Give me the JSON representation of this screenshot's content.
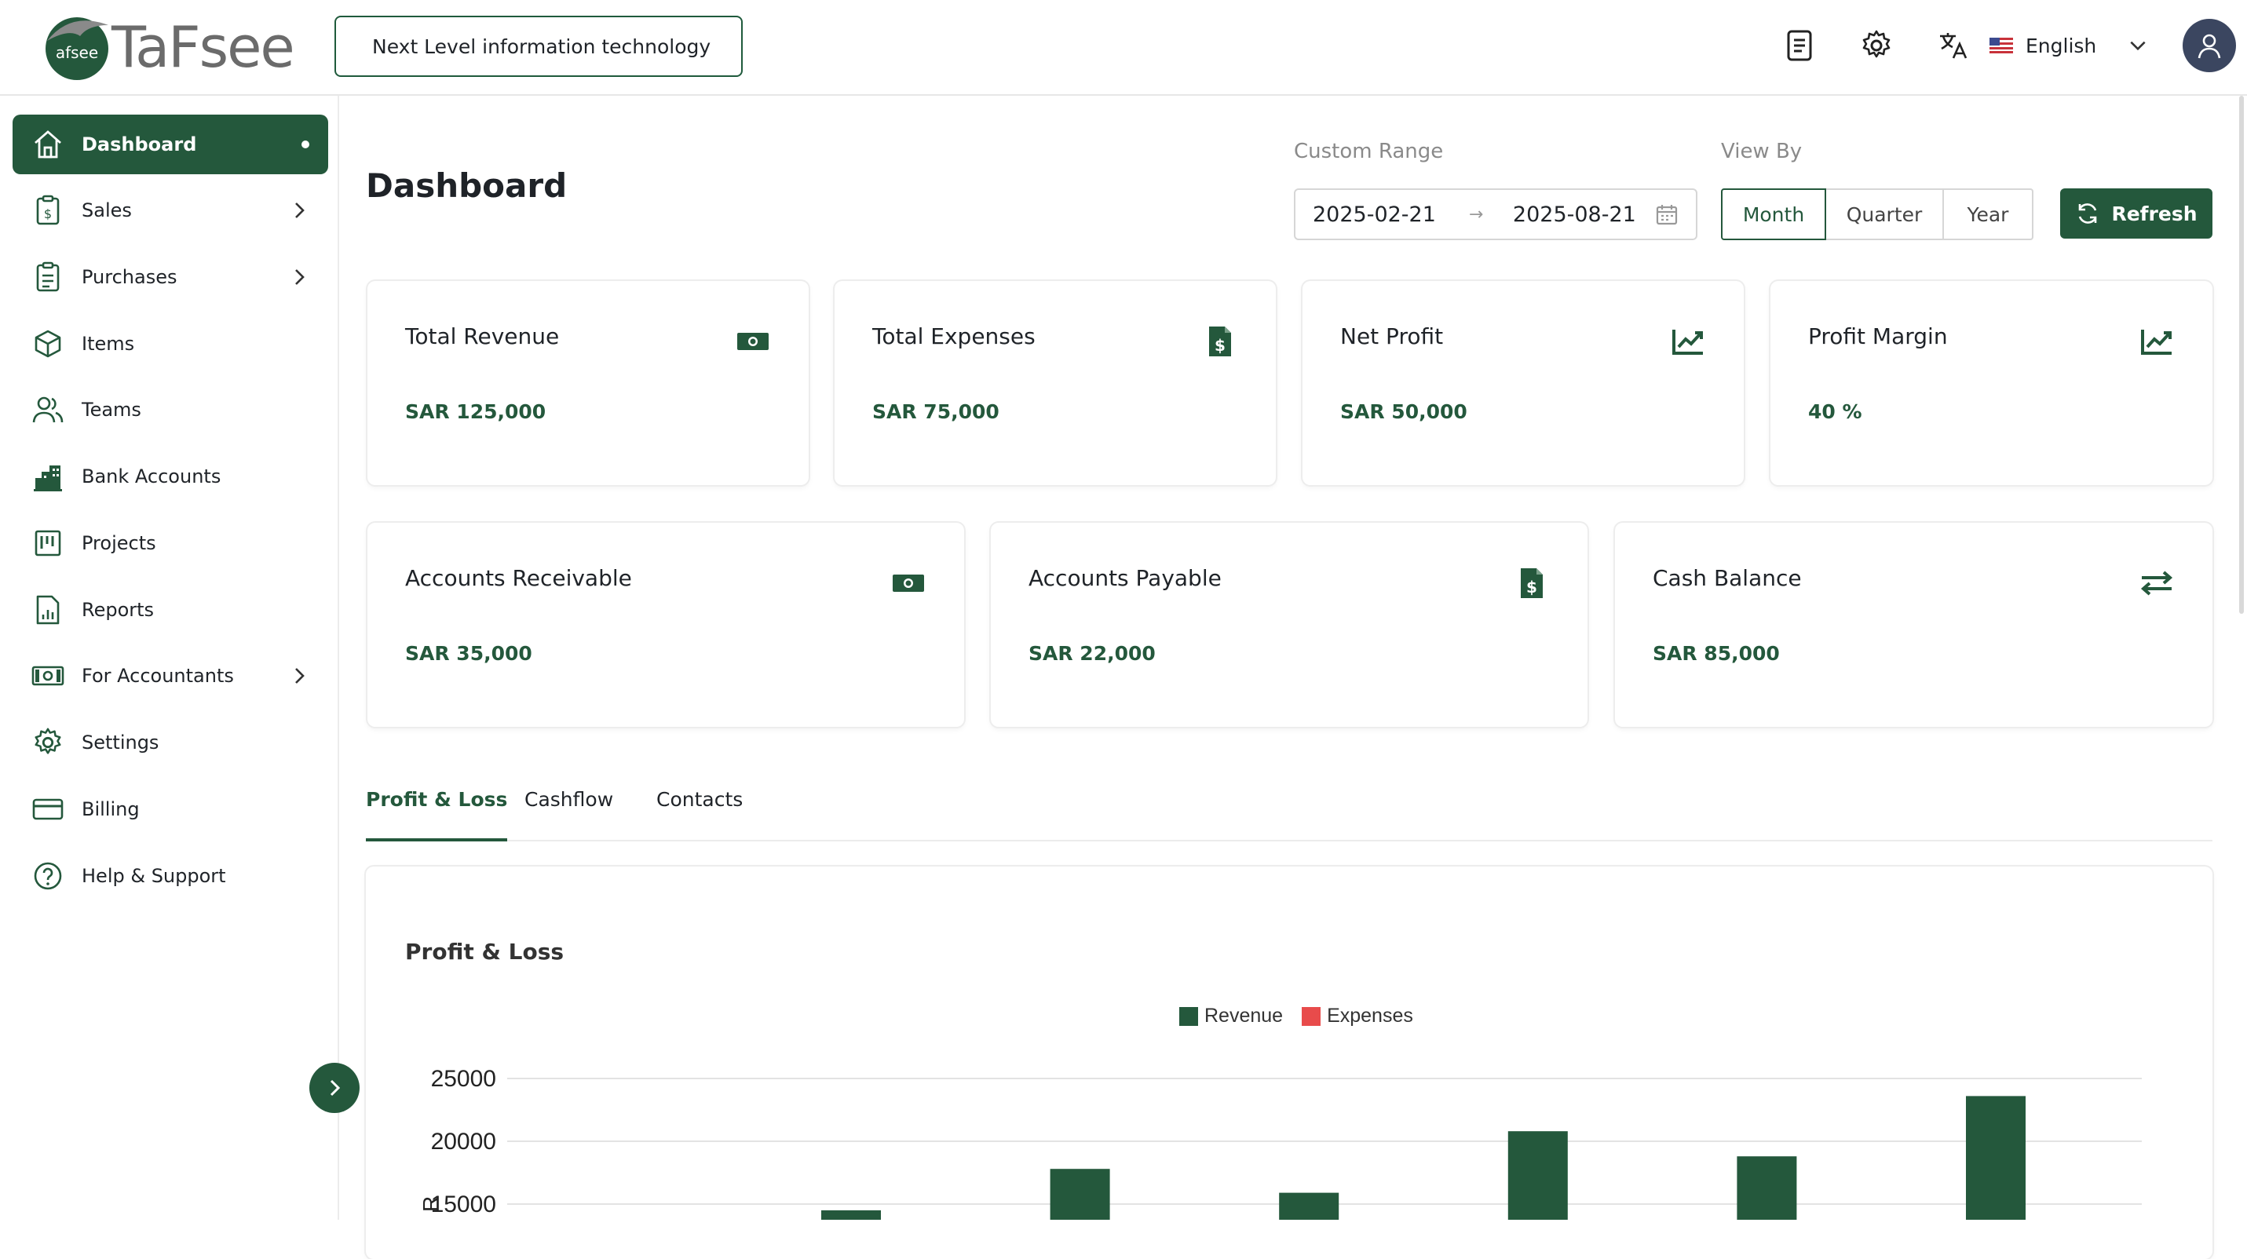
{
  "brand": {
    "name": "TaFsee",
    "mark_text": "afsee"
  },
  "header": {
    "organization": "Next Level information technology",
    "language": "English",
    "icons": [
      "document-icon",
      "gear-icon",
      "translate-icon",
      "us-flag-icon",
      "chevron-down-icon",
      "user-avatar-icon"
    ]
  },
  "sidebar": {
    "items": [
      {
        "label": "Dashboard",
        "icon": "home-icon",
        "active": true
      },
      {
        "label": "Sales",
        "icon": "receipt-icon",
        "has_children": true
      },
      {
        "label": "Purchases",
        "icon": "clipboard-icon",
        "has_children": true
      },
      {
        "label": "Items",
        "icon": "box-icon"
      },
      {
        "label": "Teams",
        "icon": "users-icon"
      },
      {
        "label": "Bank Accounts",
        "icon": "bank-icon"
      },
      {
        "label": "Projects",
        "icon": "board-icon"
      },
      {
        "label": "Reports",
        "icon": "report-icon"
      },
      {
        "label": "For Accountants",
        "icon": "cash-icon",
        "has_children": true
      },
      {
        "label": "Settings",
        "icon": "gear-icon"
      },
      {
        "label": "Billing",
        "icon": "card-icon"
      },
      {
        "label": "Help & Support",
        "icon": "help-icon"
      }
    ]
  },
  "main": {
    "title": "Dashboard",
    "custom_range_label": "Custom Range",
    "date_from": "2025-02-21",
    "date_to": "2025-08-21",
    "view_by_label": "View By",
    "view_options": [
      "Month",
      "Quarter",
      "Year"
    ],
    "view_selected": "Month",
    "refresh_label": "Refresh",
    "cards_row1": [
      {
        "title": "Total Revenue",
        "value": "SAR 125,000",
        "icon": "cash-icon"
      },
      {
        "title": "Total Expenses",
        "value": "SAR 75,000",
        "icon": "invoice-dollar-icon"
      },
      {
        "title": "Net Profit",
        "value": "SAR 50,000",
        "icon": "trend-up-icon"
      },
      {
        "title": "Profit Margin",
        "value": "40 %",
        "icon": "trend-up-icon"
      }
    ],
    "cards_row2": [
      {
        "title": "Accounts Receivable",
        "value": "SAR 35,000",
        "icon": "cash-icon"
      },
      {
        "title": "Accounts Payable",
        "value": "SAR 22,000",
        "icon": "invoice-dollar-icon"
      },
      {
        "title": "Cash Balance",
        "value": "SAR 85,000",
        "icon": "exchange-icon"
      }
    ],
    "tabs": [
      "Profit & Loss",
      "Cashflow",
      "Contacts"
    ],
    "active_tab": "Profit & Loss"
  },
  "colors": {
    "brand_green": "#24583c",
    "revenue": "#24583c",
    "expenses": "#e84b4b"
  },
  "chart_data": {
    "type": "bar",
    "title": "Profit & Loss",
    "series": [
      {
        "name": "Revenue",
        "color": "#24583c",
        "values": [
          14500,
          17800,
          15900,
          20800,
          18800,
          23600
        ]
      },
      {
        "name": "Expenses",
        "color": "#e84b4b",
        "values": []
      }
    ],
    "yticks": [
      "25000",
      "20000",
      "15000"
    ],
    "y_axis_label_fragment": "R",
    "ylim": [
      0,
      25000
    ],
    "legend_position": "top-center",
    "grid": true
  }
}
